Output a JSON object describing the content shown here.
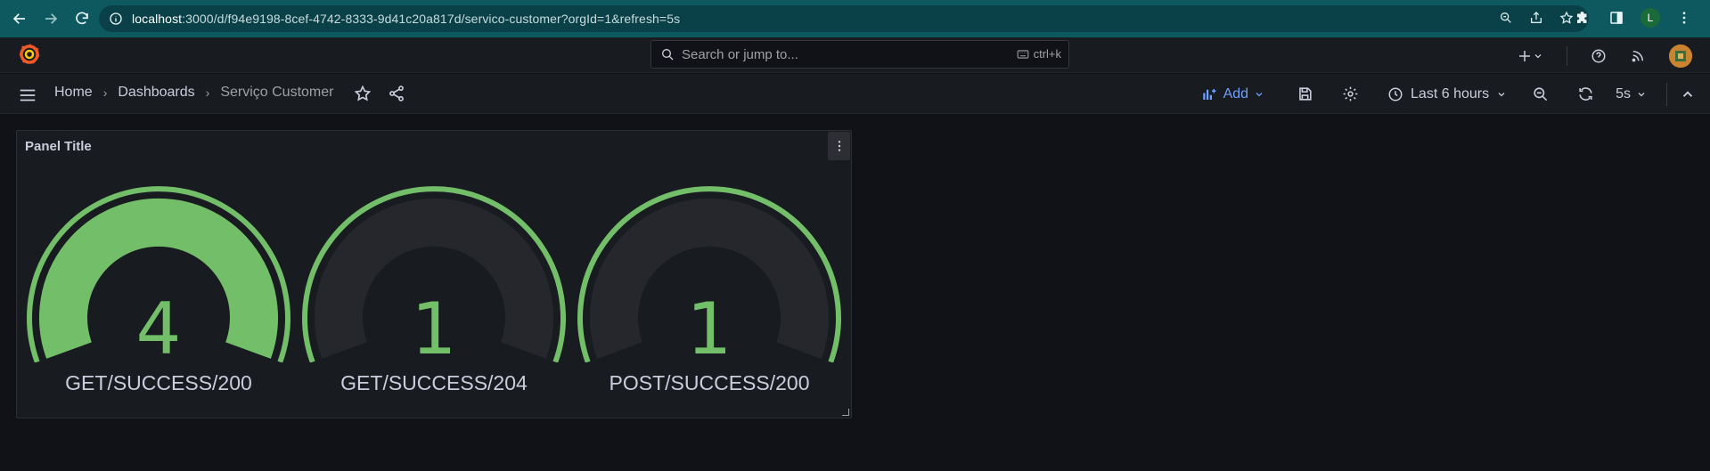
{
  "browser": {
    "url_host": "localhost",
    "url_path": ":3000/d/f94e9198-8cef-4742-8333-9d41c20a817d/servico-customer?orgId=1&refresh=5s",
    "profile_initial": "L"
  },
  "topbar": {
    "search_placeholder": "Search or jump to...",
    "shortcut": "ctrl+k"
  },
  "breadcrumbs": {
    "home": "Home",
    "dashboards": "Dashboards",
    "current": "Serviço Customer"
  },
  "toolbar": {
    "add_label": "Add",
    "time_range": "Last 6 hours",
    "refresh_interval": "5s"
  },
  "panel": {
    "title": "Panel Title",
    "gauges": [
      {
        "label": "GET/SUCCESS/200",
        "value": "4",
        "fraction": 1.0
      },
      {
        "label": "GET/SUCCESS/204",
        "value": "1",
        "fraction": 0.0
      },
      {
        "label": "POST/SUCCESS/200",
        "value": "1",
        "fraction": 0.0
      }
    ]
  },
  "colors": {
    "gauge_fill": "#73bf69",
    "gauge_track": "#25272d",
    "accent": "#6e9fff",
    "browser_bar": "#0e5960"
  }
}
